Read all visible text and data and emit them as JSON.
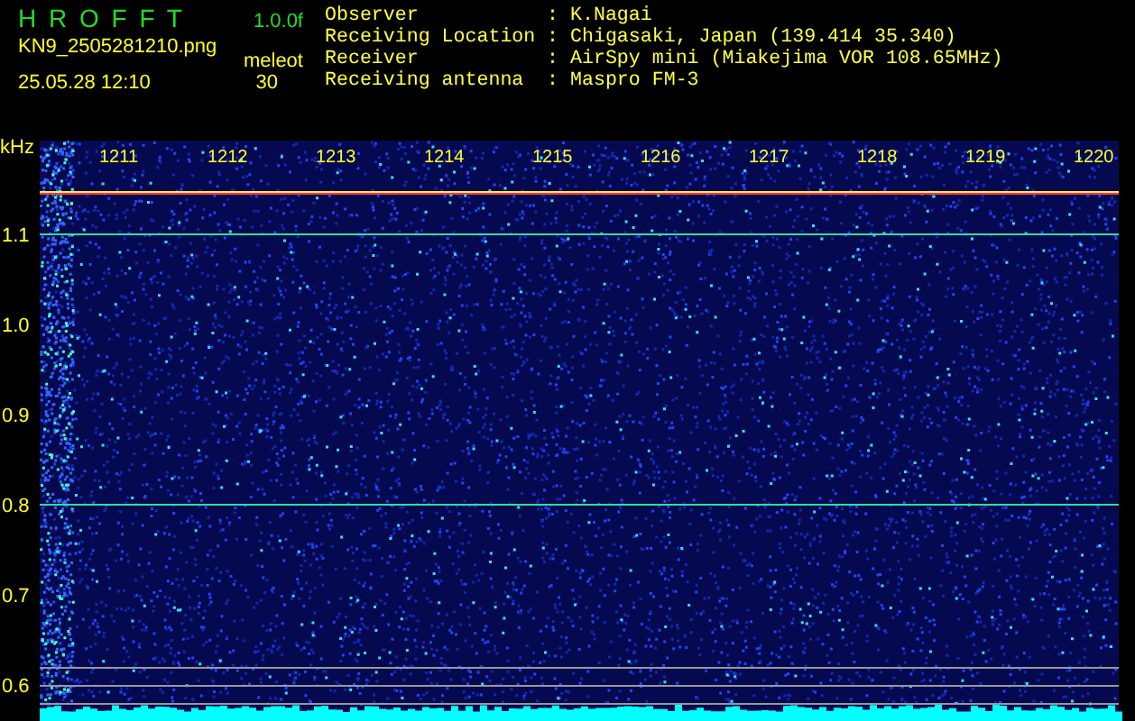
{
  "app": {
    "name": "H R O F F T",
    "version": "1.0.0f",
    "file": "KN9_2505281210.png",
    "mode": "meleot",
    "timestamp": "25.05.28 12:10",
    "count": "30"
  },
  "info": [
    {
      "label": "Observer",
      "separator": ":",
      "value": "K.Nagai"
    },
    {
      "label": "Receiving Location",
      "separator": ":",
      "value": "Chigasaki, Japan (139.414 35.340)"
    },
    {
      "label": "Receiver",
      "separator": ":",
      "value": "AirSpy mini (Miakejima VOR 108.65MHz)"
    },
    {
      "label": "Receiving antenna",
      "separator": ":",
      "value": "Maspro FM-3"
    }
  ],
  "plot": {
    "unit": "kHz",
    "y_labels": [
      "1.1",
      "1.0",
      "0.9",
      "0.8",
      "0.7",
      "0.6"
    ],
    "time_labels": [
      "1211",
      "1212",
      "1213",
      "1214",
      "1215",
      "1216",
      "1217",
      "1218",
      "1219",
      "1220"
    ]
  }
}
